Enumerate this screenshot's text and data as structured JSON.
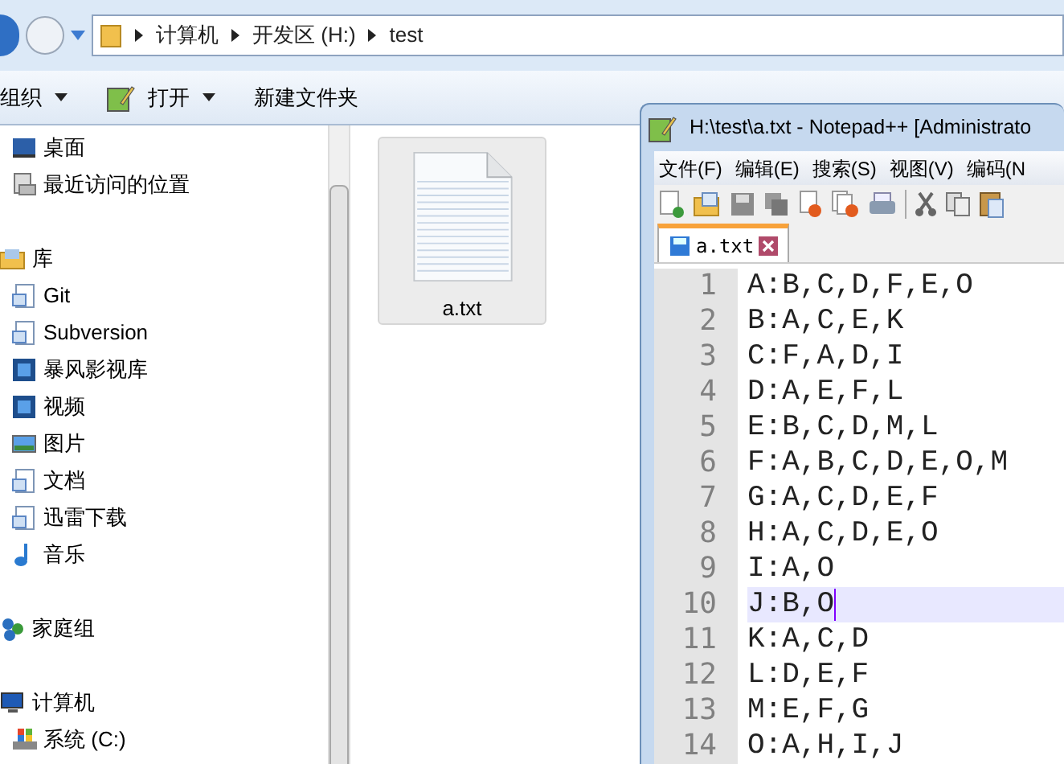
{
  "explorer": {
    "path": [
      "计算机",
      "开发区 (H:)",
      "test"
    ],
    "toolbar": [
      {
        "label": "组织",
        "dropdown": true,
        "icon": false
      },
      {
        "label": "打开",
        "dropdown": true,
        "icon": true
      },
      {
        "label": "新建文件夹",
        "dropdown": false,
        "icon": false
      }
    ],
    "sidebar": {
      "sections": [
        {
          "children": [
            {
              "label": "桌面",
              "kind": "desktop"
            },
            {
              "label": "最近访问的位置",
              "kind": "recent"
            }
          ]
        },
        {
          "label": "库",
          "kind": "library",
          "children": [
            {
              "label": "Git",
              "kind": "doc"
            },
            {
              "label": "Subversion",
              "kind": "doc"
            },
            {
              "label": "暴风影视库",
              "kind": "film"
            },
            {
              "label": "视频",
              "kind": "film"
            },
            {
              "label": "图片",
              "kind": "picture"
            },
            {
              "label": "文档",
              "kind": "doc"
            },
            {
              "label": "迅雷下载",
              "kind": "doc"
            },
            {
              "label": "音乐",
              "kind": "music"
            }
          ]
        },
        {
          "label": "家庭组",
          "kind": "homegroup"
        },
        {
          "label": "计算机",
          "kind": "computer",
          "children": [
            {
              "label": "系统 (C:)",
              "kind": "drive"
            }
          ]
        }
      ]
    },
    "files": [
      {
        "name": "a.txt",
        "selected": true
      }
    ]
  },
  "notepad": {
    "title": "H:\\test\\a.txt - Notepad++ [Administrato",
    "menu": [
      "文件(F)",
      "编辑(E)",
      "搜索(S)",
      "视图(V)",
      "编码(N"
    ],
    "tabs": [
      {
        "label": "a.txt",
        "selected": true
      }
    ],
    "lines": [
      {
        "number": "1",
        "text": "A:B,C,D,F,E,O",
        "current": false
      },
      {
        "number": "2",
        "text": "B:A,C,E,K",
        "current": false
      },
      {
        "number": "3",
        "text": "C:F,A,D,I",
        "current": false
      },
      {
        "number": "4",
        "text": "D:A,E,F,L",
        "current": false
      },
      {
        "number": "5",
        "text": "E:B,C,D,M,L",
        "current": false
      },
      {
        "number": "6",
        "text": "F:A,B,C,D,E,O,M",
        "current": false
      },
      {
        "number": "7",
        "text": "G:A,C,D,E,F",
        "current": false
      },
      {
        "number": "8",
        "text": "H:A,C,D,E,O",
        "current": false
      },
      {
        "number": "9",
        "text": "I:A,O",
        "current": false
      },
      {
        "number": "10",
        "text": "J:B,O",
        "current": true
      },
      {
        "number": "11",
        "text": "K:A,C,D",
        "current": false
      },
      {
        "number": "12",
        "text": "L:D,E,F",
        "current": false
      },
      {
        "number": "13",
        "text": "M:E,F,G",
        "current": false
      },
      {
        "number": "14",
        "text": "O:A,H,I,J",
        "current": false
      }
    ]
  }
}
